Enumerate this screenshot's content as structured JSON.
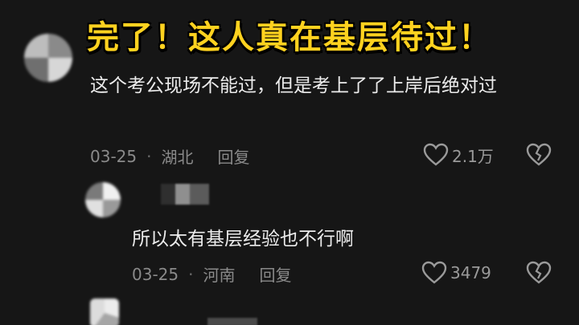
{
  "headline": "完了！这人真在基层待过！",
  "comments": [
    {
      "text": "这个考公现场不能过，但是考上了了上岸后绝对过",
      "date": "03-25",
      "separator": "·",
      "location": "湖北",
      "reply_label": "回复",
      "likes": "2.1万",
      "like_icon": "heart-outline-icon",
      "dislike_icon": "broken-heart-icon"
    },
    {
      "text": "所以太有基层经验也不行啊",
      "date": "03-25",
      "separator": "·",
      "location": "河南",
      "reply_label": "回复",
      "likes": "3479",
      "like_icon": "heart-outline-icon",
      "dislike_icon": "broken-heart-icon"
    }
  ],
  "colors": {
    "background": "#161616",
    "headline": "#ffd21f",
    "meta": "#8a8a8a"
  }
}
